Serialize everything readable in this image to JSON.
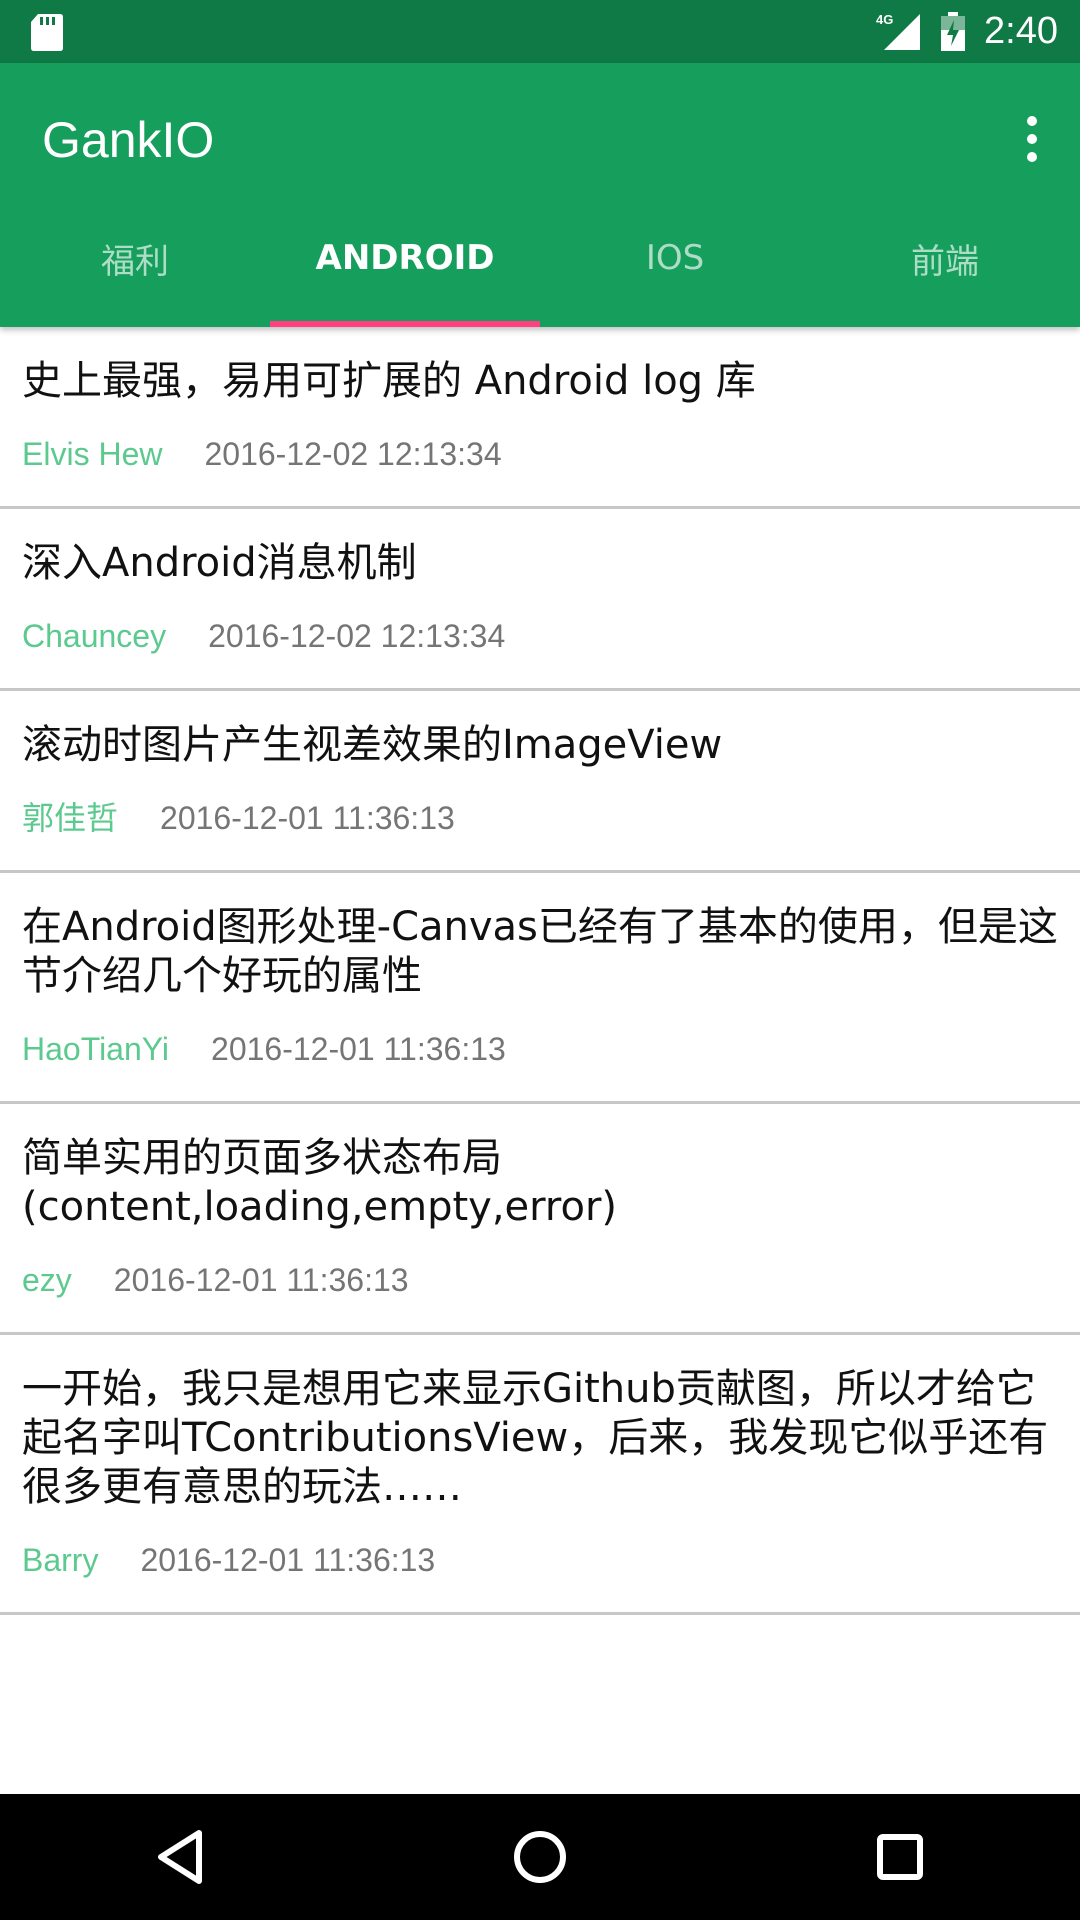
{
  "status_bar": {
    "time": "2:40",
    "network": "4G",
    "icons": [
      "sd-card-icon",
      "signal-icon",
      "battery-icon"
    ]
  },
  "app_bar": {
    "title": "GankIO",
    "overflow_icon": "more-vertical-icon"
  },
  "tabs": [
    {
      "label": "福利",
      "active": false
    },
    {
      "label": "ANDROID",
      "active": true
    },
    {
      "label": "IOS",
      "active": false
    },
    {
      "label": "前端",
      "active": false
    }
  ],
  "items": [
    {
      "title": "史上最强，易用可扩展的 Android log 库",
      "author": "Elvis Hew",
      "date": "2016-12-02 12:13:34"
    },
    {
      "title": "深入Android消息机制",
      "author": "Chauncey",
      "date": "2016-12-02 12:13:34"
    },
    {
      "title": "滚动时图片产生视差效果的ImageView",
      "author": "郭佳哲",
      "date": "2016-12-01 11:36:13"
    },
    {
      "title": "在Android图形处理-Canvas已经有了基本的使用，但是这节介绍几个好玩的属性",
      "author": "HaoTianYi",
      "date": "2016-12-01 11:36:13"
    },
    {
      "title": "简单实用的页面多状态布局(content,loading,empty,error)",
      "author": "ezy",
      "date": "2016-12-01 11:36:13"
    },
    {
      "title": "一开始，我只是想用它来显示Github贡献图，所以才给它起名字叫TContributionsView，后来，我发现它似乎还有很多更有意思的玩法……",
      "author": "Barry",
      "date": "2016-12-01 11:36:13"
    }
  ],
  "colors": {
    "status_bar": "#0f7a45",
    "primary": "#169e5c",
    "indicator": "#ff4081",
    "author": "#5cc98f",
    "date": "#757575"
  },
  "nav_bar": {
    "buttons": [
      "back-icon",
      "home-icon",
      "recents-icon"
    ]
  }
}
